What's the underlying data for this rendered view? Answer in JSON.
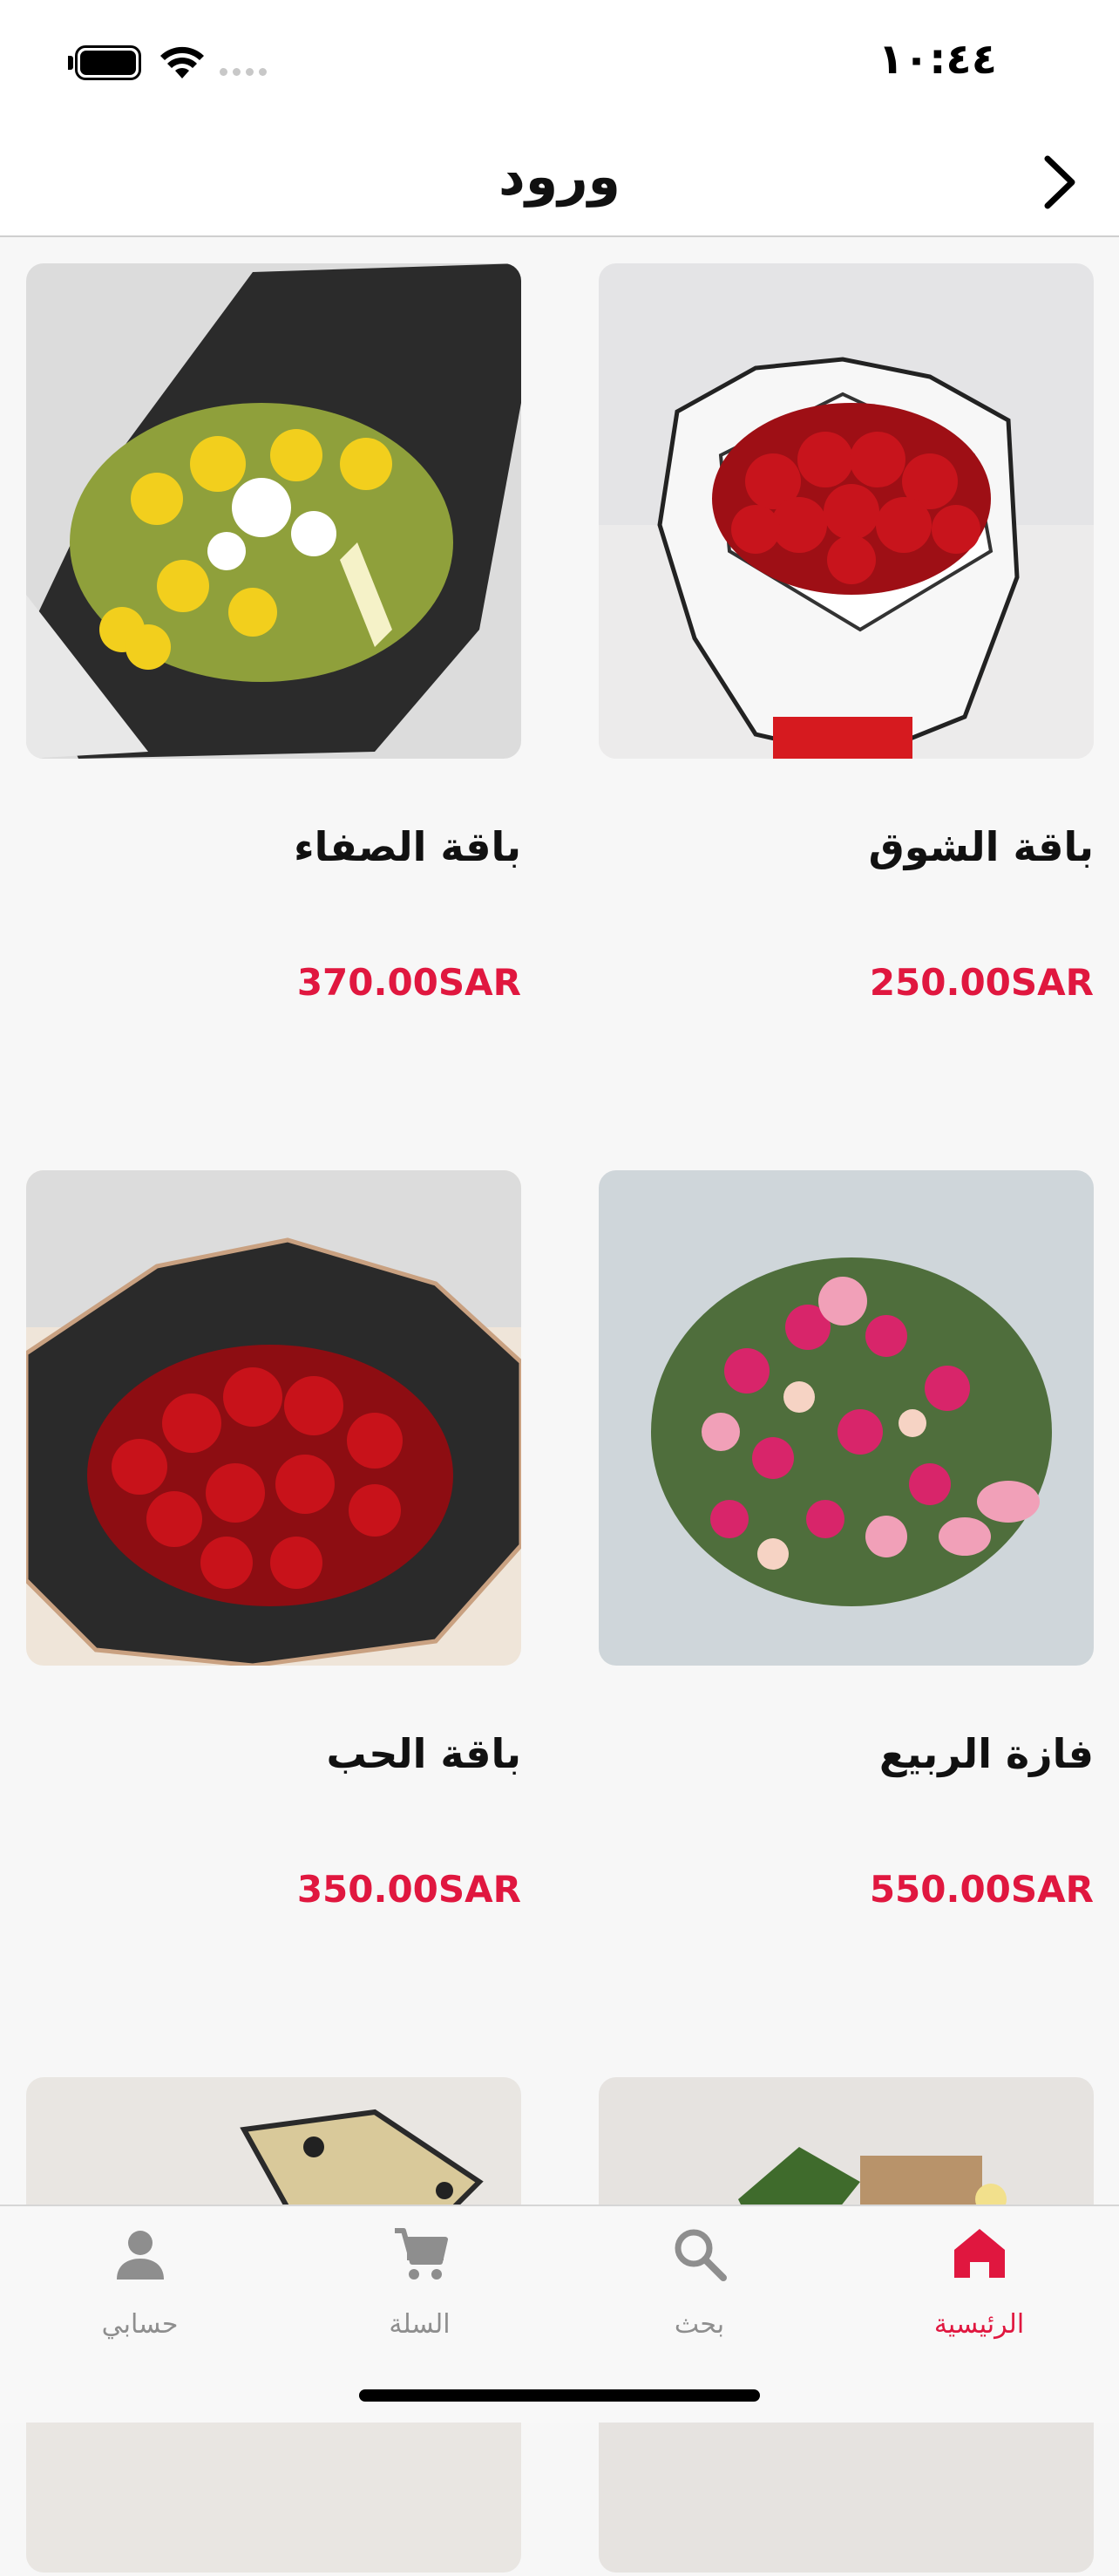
{
  "status_bar": {
    "time": "١٠:٤٤"
  },
  "nav": {
    "title": "ورود"
  },
  "products": [
    {
      "name": "باقة الشوق",
      "price": "250.00SAR"
    },
    {
      "name": "باقة الصفاء",
      "price": "370.00SAR"
    },
    {
      "name": "فازة الربيع",
      "price": "550.00SAR"
    },
    {
      "name": "باقة الحب",
      "price": "350.00SAR"
    },
    {
      "name": "",
      "price": ""
    },
    {
      "name": "",
      "price": ""
    }
  ],
  "tab_bar": {
    "items": [
      {
        "label": "الرئيسية",
        "icon": "home-icon",
        "active": true
      },
      {
        "label": "بحث",
        "icon": "search-icon",
        "active": false
      },
      {
        "label": "السلة",
        "icon": "cart-icon",
        "active": false
      },
      {
        "label": "حسابي",
        "icon": "person-icon",
        "active": false
      }
    ]
  },
  "colors": {
    "accent": "#e0173f",
    "inactive": "#8e8e8e",
    "background": "#f7f7f7"
  }
}
